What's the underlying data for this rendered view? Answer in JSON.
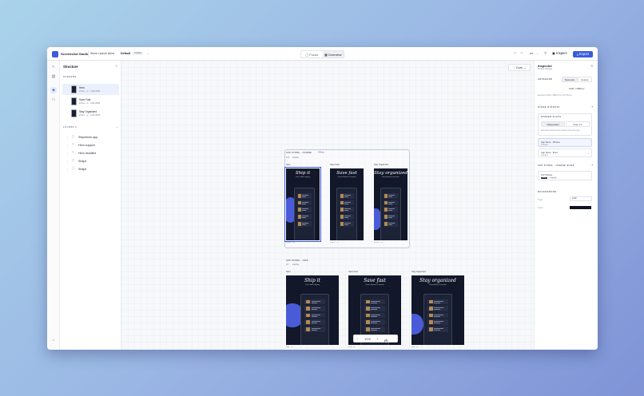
{
  "app": {
    "title": "Screenshot Studio",
    "project": "Stone Launch Items",
    "preset": "Default",
    "preset_badge": "Untitled"
  },
  "toolbar": {
    "focus_label": "Focus",
    "overview_label": "Overview",
    "language": "en",
    "inspect_label": "Inspect",
    "export_label": "Export"
  },
  "structure": {
    "title": "Structure",
    "screens_label": "SCREENS",
    "screens": [
      {
        "name": "Hero",
        "meta": "iphone · en · 1320×2868"
      },
      {
        "name": "Save Fast",
        "meta": "iphone · en · 1320×2868"
      },
      {
        "name": "Stay Organized",
        "meta": "iphone · en · 1320×2868"
      }
    ],
    "layers_label": "LAYERS",
    "layers_count": "5",
    "layers": [
      {
        "name": "Shipments app"
      },
      {
        "name": "Hero support"
      },
      {
        "name": "Hero headline"
      },
      {
        "name": "Shape"
      },
      {
        "name": "Shape"
      }
    ]
  },
  "canvas": {
    "dots_label": "Dots",
    "groups": [
      {
        "label": "APP STORE · IPHONE",
        "badge": "Editing",
        "size_label": "6.9\"",
        "sub_badge": "inactive",
        "screens": [
          {
            "name": "Hero",
            "headline": "Ship it",
            "sub": "Fast, reliable shipping",
            "meta": "iphone · en"
          },
          {
            "name": "Save Fast",
            "headline": "Save fast",
            "sub": "Create shipments in seconds",
            "meta": "iphone · en"
          },
          {
            "name": "Stay Organized",
            "headline": "Stay organized",
            "sub": "Every delivery in one place",
            "meta": "iphone · en"
          }
        ]
      },
      {
        "label": "APP STORE · IPAD",
        "size_label": "13\"",
        "sub_badge": "inactive",
        "screens": [
          {
            "name": "Hero",
            "headline": "Ship it",
            "sub": "Fast, reliable shipping",
            "meta": "ipad · en"
          },
          {
            "name": "Save Fast",
            "headline": "Save fast",
            "sub": "Create shipments in seconds",
            "meta": "ipad · en"
          },
          {
            "name": "Stay Organized",
            "headline": "Stay organized",
            "sub": "Every delivery in one place",
            "meta": "ipad · en"
          }
        ]
      }
    ],
    "zoom": "12%",
    "fit_label": "Fit"
  },
  "inspector": {
    "title": "Inspector",
    "subtitle": "Screen settings",
    "artboard_label": "ARTBOARD",
    "artboard_options": [
      "Store size",
      "Custom"
    ],
    "artboard_size": "1320 × 2868 px",
    "artboard_note": "Exports at 1320 × 2868 px for 6.9\" iPhone",
    "store_outputs_label": "STORE OUTPUTS",
    "screen_slots_label": "SCREEN SLOTS",
    "slot_options": [
      "Independent",
      "Keep 1:1"
    ],
    "slot_note": "Each size keeps its own content order and copy",
    "outputs": [
      {
        "name": "App Store · iPhone",
        "status": "Included"
      },
      {
        "name": "App Store · iPad",
        "status": "Included"
      }
    ],
    "iphone_sizes_label": "APP STORE · IPHONE SIZES",
    "size_name": "6.9\" iPhone",
    "size_chips": [
      "1320",
      "required"
    ],
    "background_label": "BACKGROUND",
    "type_label": "Type",
    "type_value": "solid",
    "color_label": "Color",
    "color_value": "#0f1322"
  },
  "colors": {
    "accent": "#3b5bdb",
    "screen_bg": "#121729",
    "blob": "#4a5bd8"
  }
}
